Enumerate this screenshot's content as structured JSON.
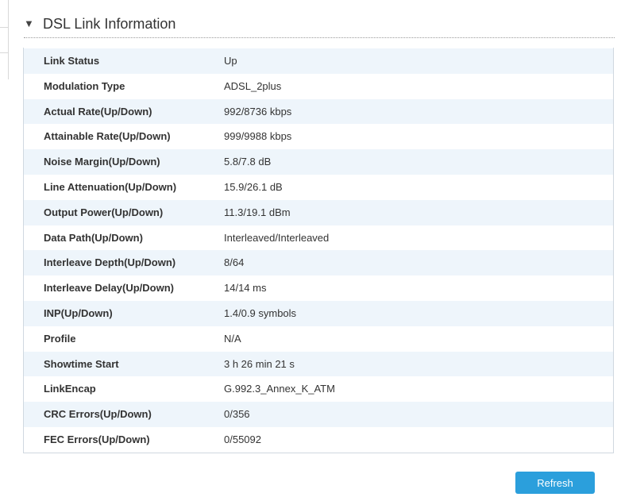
{
  "section": {
    "toggle_glyph": "▼",
    "title": "DSL Link Information"
  },
  "rows": [
    {
      "label": "Link Status",
      "value": "Up"
    },
    {
      "label": "Modulation Type",
      "value": "ADSL_2plus"
    },
    {
      "label": "Actual Rate(Up/Down)",
      "value": "992/8736 kbps"
    },
    {
      "label": "Attainable Rate(Up/Down)",
      "value": "999/9988 kbps"
    },
    {
      "label": "Noise Margin(Up/Down)",
      "value": "5.8/7.8 dB"
    },
    {
      "label": "Line Attenuation(Up/Down)",
      "value": "15.9/26.1 dB"
    },
    {
      "label": "Output Power(Up/Down)",
      "value": "11.3/19.1 dBm"
    },
    {
      "label": "Data Path(Up/Down)",
      "value": "Interleaved/Interleaved"
    },
    {
      "label": "Interleave Depth(Up/Down)",
      "value": "8/64"
    },
    {
      "label": "Interleave Delay(Up/Down)",
      "value": "14/14 ms"
    },
    {
      "label": "INP(Up/Down)",
      "value": "1.4/0.9 symbols"
    },
    {
      "label": "Profile",
      "value": "N/A"
    },
    {
      "label": "Showtime Start",
      "value": "3 h 26 min 21 s"
    },
    {
      "label": "LinkEncap",
      "value": "G.992.3_Annex_K_ATM"
    },
    {
      "label": "CRC Errors(Up/Down)",
      "value": "0/356"
    },
    {
      "label": "FEC Errors(Up/Down)",
      "value": "0/55092"
    }
  ],
  "actions": {
    "refresh_label": "Refresh"
  },
  "colors": {
    "row_shade": "#eef5fb",
    "button_bg": "#2b9fdc",
    "button_text": "#ffffff"
  }
}
